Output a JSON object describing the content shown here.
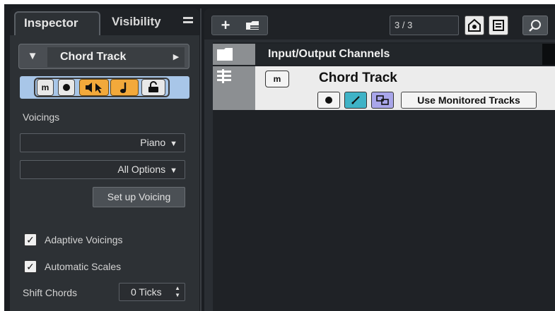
{
  "inspector": {
    "tabs": [
      {
        "label": "Inspector",
        "active": true
      },
      {
        "label": "Visibility",
        "active": false
      }
    ],
    "track_name": "Chord Track",
    "voicings_label": "Voicings",
    "voicing_preset": "Piano",
    "voicing_options": "All Options",
    "setup_voicing_label": "Set up Voicing",
    "adaptive_voicings": {
      "label": "Adaptive Voicings",
      "checked": true
    },
    "automatic_scales": {
      "label": "Automatic Scales",
      "checked": true
    },
    "shift_chords_label": "Shift Chords",
    "shift_chords_value": "0 Ticks",
    "strip_buttons": {
      "mute": "m"
    }
  },
  "project": {
    "counter": "3 / 3",
    "folder_track": "Input/Output Channels",
    "chord_track": {
      "name": "Chord Track",
      "mute_label": "m",
      "use_monitored_label": "Use Monitored Tracks"
    }
  },
  "colors": {
    "accent_orange": "#f2a93b",
    "strip_blue": "#a8c6e8",
    "teal_button": "#3fb3c7",
    "purple_button": "#a9a6ea"
  }
}
